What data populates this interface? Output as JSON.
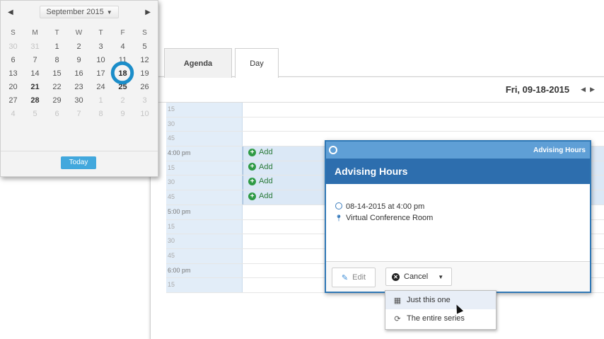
{
  "mini_calendar": {
    "month_label": "September 2015",
    "prev_icon": "triangle-left-icon",
    "next_icon": "triangle-right-icon",
    "weekdays": [
      "S",
      "M",
      "T",
      "W",
      "T",
      "F",
      "S"
    ],
    "weeks": [
      [
        "30",
        "31",
        "1",
        "2",
        "3",
        "4",
        "5"
      ],
      [
        "6",
        "7",
        "8",
        "9",
        "10",
        "11",
        "12"
      ],
      [
        "13",
        "14",
        "15",
        "16",
        "17",
        "18",
        "19"
      ],
      [
        "20",
        "21",
        "22",
        "23",
        "24",
        "25",
        "26"
      ],
      [
        "27",
        "28",
        "29",
        "30",
        "1",
        "2",
        "3"
      ],
      [
        "4",
        "5",
        "6",
        "7",
        "8",
        "9",
        "10"
      ]
    ],
    "selected_day": "18",
    "today_label": "Today"
  },
  "tabs": [
    {
      "label": "Agenda"
    },
    {
      "label": "Day"
    }
  ],
  "header": {
    "date": "Fri, 09-18-2015"
  },
  "slots": [
    {
      "time": "15",
      "hour": false,
      "busy": false,
      "add": false
    },
    {
      "time": "30",
      "hour": false,
      "busy": false,
      "add": false
    },
    {
      "time": "45",
      "hour": false,
      "busy": false,
      "add": false
    },
    {
      "time": "4:00 pm",
      "hour": true,
      "busy": true,
      "add": true
    },
    {
      "time": "15",
      "hour": false,
      "busy": true,
      "add": true
    },
    {
      "time": "30",
      "hour": false,
      "busy": true,
      "add": true
    },
    {
      "time": "45",
      "hour": false,
      "busy": true,
      "add": true
    },
    {
      "time": "5:00 pm",
      "hour": true,
      "busy": false,
      "add": false
    },
    {
      "time": "15",
      "hour": false,
      "busy": false,
      "add": false
    },
    {
      "time": "30",
      "hour": false,
      "busy": false,
      "add": false
    },
    {
      "time": "45",
      "hour": false,
      "busy": false,
      "add": false
    },
    {
      "time": "6:00 pm",
      "hour": true,
      "busy": false,
      "add": false
    },
    {
      "time": "15",
      "hour": false,
      "busy": false,
      "add": false
    }
  ],
  "add_label": "Add",
  "popup": {
    "strip_title": "Advising Hours",
    "title": "Advising Hours",
    "datetime": "08-14-2015 at 4:00 pm",
    "location": "Virtual Conference Room",
    "edit_label": "Edit",
    "cancel_label": "Cancel"
  },
  "dropdown": {
    "items": [
      {
        "label": "Just this one",
        "icon": "calendar-icon"
      },
      {
        "label": "The entire series",
        "icon": "refresh-icon"
      }
    ]
  },
  "colors": {
    "accent": "#2d6eae",
    "selection_ring": "#1b8dc9",
    "today_button": "#42a8dd",
    "add_green": "#2f9a45"
  }
}
